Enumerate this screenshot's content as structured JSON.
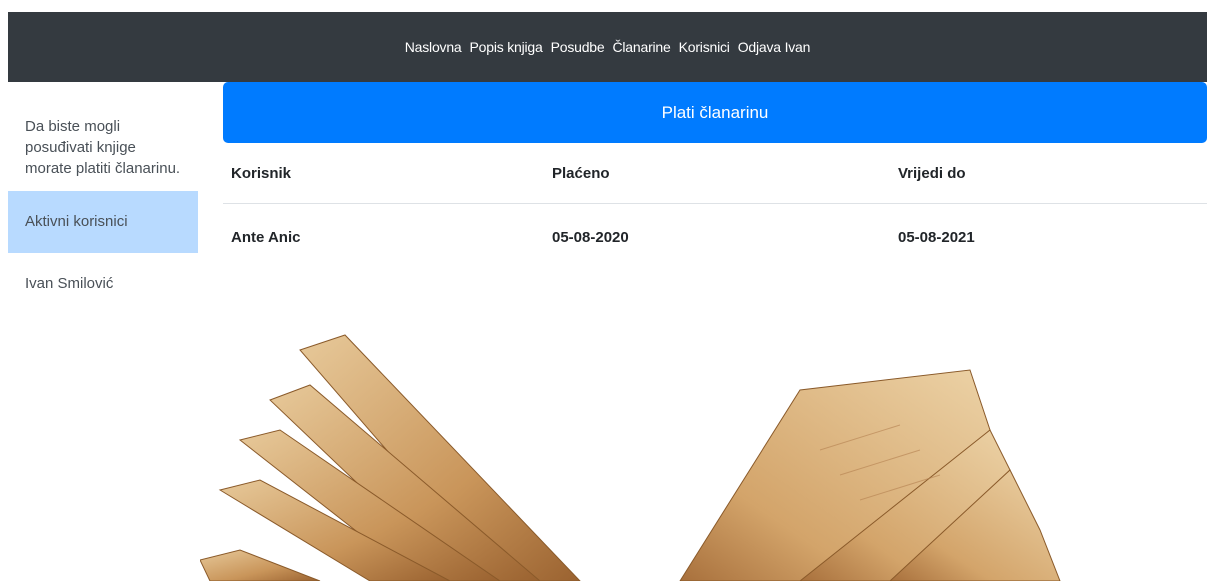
{
  "nav": {
    "items": [
      "Naslovna",
      "Popis knjiga",
      "Posudbe",
      "Članarine",
      "Korisnici",
      "Odjava Ivan"
    ]
  },
  "sidebar": {
    "note": "Da biste mogli posuđivati knjige morate platiti članarinu.",
    "items": [
      {
        "label": "Aktivni korisnici",
        "active": true
      },
      {
        "label": "Ivan Smilović",
        "active": false
      }
    ]
  },
  "main": {
    "pay_button": "Plati članarinu",
    "table": {
      "headers": [
        "Korisnik",
        "Plaćeno",
        "Vrijedi do"
      ],
      "rows": [
        [
          "Ante Anic",
          "05-08-2020",
          "05-08-2021"
        ]
      ]
    }
  },
  "colors": {
    "navbar": "#343a40",
    "primary": "#007bff",
    "active_item": "#b8daff"
  }
}
